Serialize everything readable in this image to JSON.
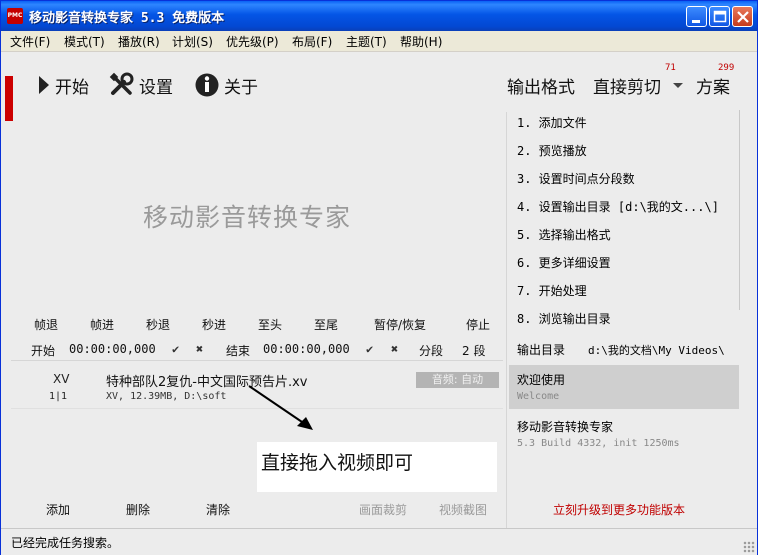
{
  "window": {
    "app_icon_text": "PMC",
    "title": "移动影音转换专家 5.3 免费版本"
  },
  "menu": [
    "文件(F)",
    "模式(T)",
    "播放(R)",
    "计划(S)",
    "优先级(P)",
    "布局(F)",
    "主题(T)",
    "帮助(H)"
  ],
  "toolbar": {
    "start": "开始",
    "settings": "设置",
    "about": "关于",
    "output_format": "输出格式",
    "direct_cut": "直接剪切",
    "direct_cut_badge": "71",
    "scheme": "方案",
    "scheme_badge": "299"
  },
  "watermark": "移动影音转换专家",
  "steps": [
    "1. 添加文件",
    "2. 预览播放",
    "3. 设置时间点分段数",
    "4. 设置输出目录 [d:\\我的文...\\]",
    "5. 选择输出格式",
    "6. 更多详细设置",
    "7. 开始处理",
    "8. 浏览输出目录"
  ],
  "output_dir": {
    "label": "输出目录",
    "value": "d:\\我的文档\\My Videos\\"
  },
  "playback_controls": [
    "帧退",
    "帧进",
    "秒退",
    "秒进",
    "至头",
    "至尾",
    "暂停/恢复",
    "停止"
  ],
  "time_row": {
    "start_label": "开始",
    "start_time": "00:00:00,000",
    "end_label": "结束",
    "end_time": "00:00:00,000",
    "segment_label": "分段",
    "segment_value": "2 段"
  },
  "file": {
    "type": "XV",
    "index": "1|1",
    "name": "特种部队2复仇-中文国际预告片.xv",
    "meta": "XV, 12.39MB, D:\\soft",
    "audio_badge": "音频: 自动"
  },
  "hint": "直接拖入视频即可",
  "welcome": {
    "title": "欢迎使用",
    "subtitle": "Welcome"
  },
  "about_card": {
    "title": "移动影音转换专家",
    "subtitle": "5.3 Build 4332, init 1250ms"
  },
  "bottom_buttons": {
    "add": "添加",
    "delete": "删除",
    "clear": "清除",
    "crop": "画面裁剪",
    "snapshot": "视频截图",
    "upgrade": "立刻升级到更多功能版本"
  },
  "status": "已经完成任务搜索。",
  "colors": {
    "titlebar": "#0455e6",
    "accent_red": "#c00000",
    "background": "#ececec"
  }
}
